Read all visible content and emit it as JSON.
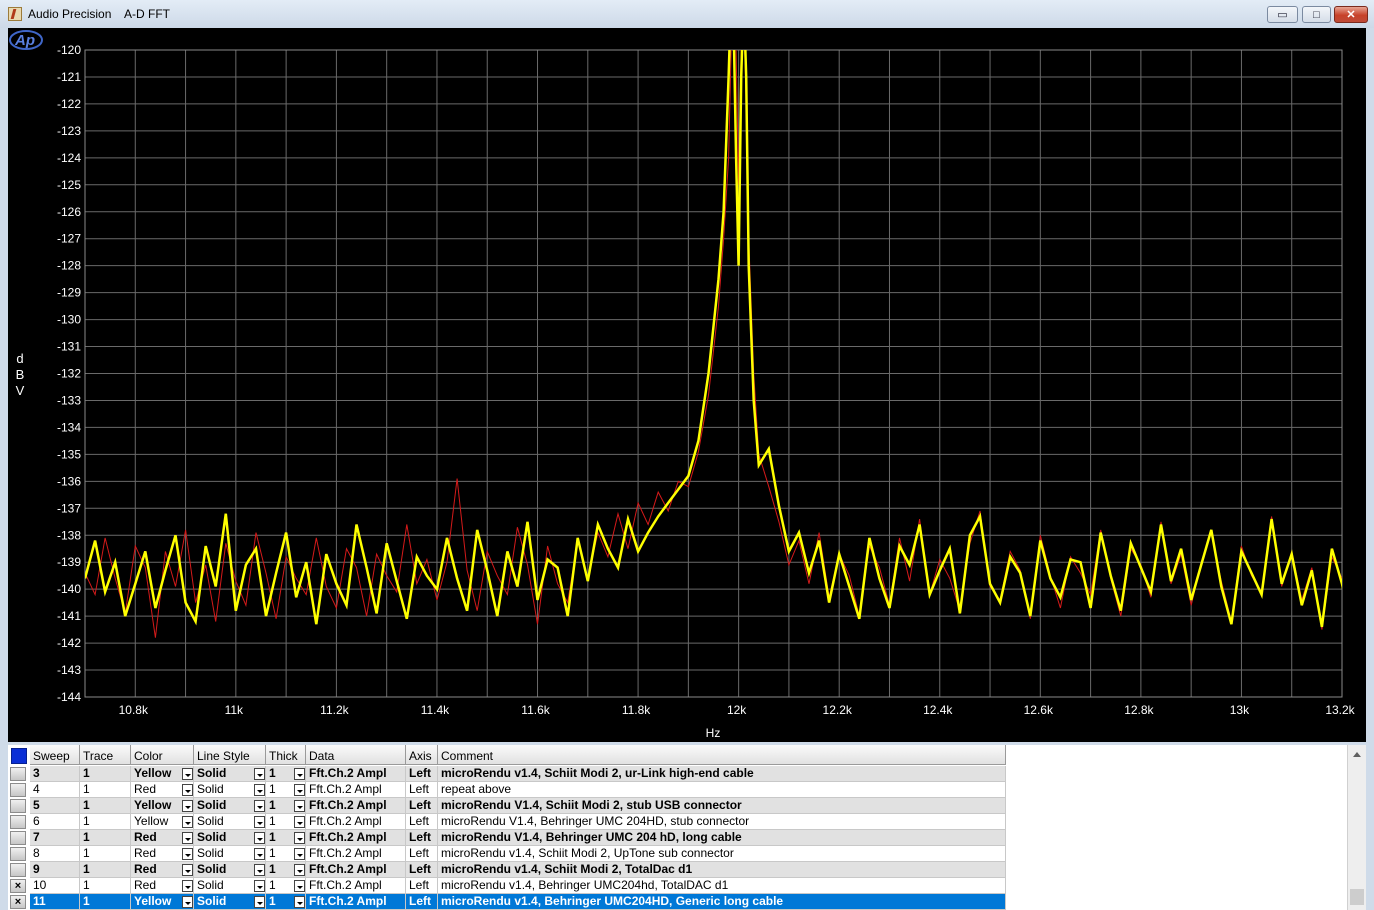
{
  "window": {
    "app_name": "Audio Precision",
    "document_title": "A-D FFT",
    "minimize": "▭",
    "maximize": "□",
    "close": "✕"
  },
  "chart_data": {
    "type": "line",
    "x": [
      10700,
      10720,
      10740,
      10760,
      10780,
      10800,
      10820,
      10840,
      10860,
      10880,
      10900,
      10920,
      10940,
      10960,
      10980,
      11000,
      11020,
      11040,
      11060,
      11080,
      11100,
      11120,
      11140,
      11160,
      11180,
      11200,
      11220,
      11240,
      11260,
      11280,
      11300,
      11320,
      11340,
      11360,
      11380,
      11400,
      11420,
      11440,
      11460,
      11480,
      11500,
      11520,
      11540,
      11560,
      11580,
      11600,
      11620,
      11640,
      11660,
      11680,
      11700,
      11720,
      11740,
      11760,
      11780,
      11800,
      11820,
      11840,
      11860,
      11880,
      11900,
      11920,
      11940,
      11960,
      11970,
      11980,
      11985,
      11990,
      11995,
      12000,
      12005,
      12010,
      12015,
      12020,
      12030,
      12040,
      12060,
      12080,
      12100,
      12120,
      12140,
      12160,
      12180,
      12200,
      12220,
      12240,
      12260,
      12280,
      12300,
      12320,
      12340,
      12360,
      12380,
      12400,
      12420,
      12440,
      12460,
      12480,
      12500,
      12520,
      12540,
      12560,
      12580,
      12600,
      12620,
      12640,
      12660,
      12680,
      12700,
      12720,
      12740,
      12760,
      12780,
      12800,
      12820,
      12840,
      12860,
      12880,
      12900,
      12920,
      12940,
      12960,
      12980,
      13000,
      13020,
      13040,
      13060,
      13080,
      13100,
      13120,
      13140,
      13160,
      13180,
      13200,
      13220
    ],
    "series": [
      {
        "color": "#d41a1a",
        "values": [
          -139.4,
          -140.2,
          -138.1,
          -139.6,
          -140.9,
          -138.4,
          -139.2,
          -141.8,
          -138.6,
          -139.9,
          -137.8,
          -140.5,
          -139.1,
          -141.2,
          -138.3,
          -139.7,
          -140.6,
          -137.9,
          -139.4,
          -141.1,
          -138.8,
          -139.6,
          -140.2,
          -138.1,
          -139.9,
          -140.7,
          -138.5,
          -139.2,
          -141.0,
          -138.7,
          -139.5,
          -140.1,
          -137.6,
          -139.8,
          -138.9,
          -140.4,
          -139.0,
          -135.9,
          -139.3,
          -140.8,
          -138.6,
          -139.5,
          -140.2,
          -137.7,
          -139.1,
          -141.3,
          -138.4,
          -139.8,
          -140.5,
          -138.2,
          -139.6,
          -137.9,
          -138.8,
          -137.2,
          -138.5,
          -136.8,
          -137.6,
          -136.4,
          -137.1,
          -136.0,
          -136.2,
          -134.9,
          -132.8,
          -129.5,
          -127.0,
          -124.0,
          -120.0,
          -118.5,
          -120.0,
          -125.0,
          -120.0,
          -118.5,
          -122.0,
          -127.0,
          -132.0,
          -135.0,
          -136.2,
          -137.5,
          -139.1,
          -138.2,
          -139.8,
          -137.9,
          -140.3,
          -138.7,
          -139.5,
          -141.0,
          -138.4,
          -139.2,
          -140.6,
          -138.1,
          -139.7,
          -137.4,
          -140.2,
          -138.9,
          -139.6,
          -140.8,
          -138.3,
          -137.1,
          -139.9,
          -140.4,
          -138.6,
          -139.3,
          -141.1,
          -138.0,
          -139.5,
          -140.7,
          -138.8,
          -139.4,
          -140.2,
          -137.8,
          -139.6,
          -141.0,
          -138.5,
          -139.1,
          -140.3,
          -137.5,
          -139.8,
          -138.7,
          -140.6,
          -139.0,
          -137.9,
          -139.7,
          -141.2,
          -138.4,
          -139.5,
          -140.1,
          -137.3,
          -139.9,
          -138.6,
          -140.4,
          -139.2,
          -141.5,
          -138.8,
          -139.6,
          -142.0
        ]
      },
      {
        "color": "#ffff00",
        "values": [
          -139.6,
          -138.2,
          -140.1,
          -139.0,
          -141.0,
          -139.8,
          -138.6,
          -140.7,
          -139.3,
          -138.0,
          -140.5,
          -141.2,
          -138.4,
          -139.9,
          -137.2,
          -140.8,
          -139.1,
          -138.5,
          -141.0,
          -139.4,
          -137.9,
          -140.3,
          -139.0,
          -141.3,
          -138.7,
          -139.8,
          -140.6,
          -137.6,
          -139.2,
          -140.9,
          -138.3,
          -139.7,
          -141.1,
          -138.8,
          -139.5,
          -140.0,
          -138.1,
          -139.6,
          -140.8,
          -137.8,
          -139.3,
          -141.0,
          -138.6,
          -139.9,
          -137.5,
          -140.4,
          -138.9,
          -139.2,
          -141.0,
          -138.1,
          -139.7,
          -137.6,
          -138.5,
          -139.2,
          -137.4,
          -138.6,
          -137.9,
          -137.3,
          -136.8,
          -136.3,
          -135.8,
          -134.5,
          -132.0,
          -128.5,
          -126.0,
          -121.0,
          -118.0,
          -119.0,
          -124.0,
          -128.0,
          -121.0,
          -118.0,
          -121.0,
          -128.0,
          -133.0,
          -135.4,
          -134.8,
          -136.9,
          -138.6,
          -137.9,
          -139.4,
          -138.2,
          -140.5,
          -138.7,
          -139.9,
          -141.1,
          -138.1,
          -139.6,
          -140.7,
          -138.4,
          -139.1,
          -137.6,
          -140.2,
          -139.3,
          -138.5,
          -140.9,
          -138.0,
          -137.3,
          -139.8,
          -140.5,
          -138.8,
          -139.4,
          -141.0,
          -138.2,
          -139.6,
          -140.3,
          -138.9,
          -139.0,
          -140.7,
          -137.9,
          -139.5,
          -140.8,
          -138.3,
          -139.2,
          -140.1,
          -137.6,
          -139.7,
          -138.5,
          -140.4,
          -139.1,
          -137.8,
          -139.9,
          -141.3,
          -138.6,
          -139.4,
          -140.2,
          -137.4,
          -139.8,
          -138.7,
          -140.6,
          -139.3,
          -141.4,
          -138.5,
          -139.8,
          -141.6
        ]
      }
    ],
    "xlim": [
      10700,
      13200
    ],
    "ylim": [
      -144,
      -120
    ],
    "xlabel": "Hz",
    "ylabel": "dBV",
    "ylabel_letters": [
      "d",
      "B",
      "V"
    ],
    "yticks": [
      -120,
      -121,
      -122,
      -123,
      -124,
      -125,
      -126,
      -127,
      -128,
      -129,
      -130,
      -131,
      -132,
      -133,
      -134,
      -135,
      -136,
      -137,
      -138,
      -139,
      -140,
      -141,
      -142,
      -143,
      -144
    ],
    "xticks": [
      10800,
      11000,
      11200,
      11400,
      11600,
      11800,
      12000,
      12200,
      12400,
      12600,
      12800,
      13000,
      13200
    ],
    "ytick_labels": [
      "-120",
      "-121",
      "-122",
      "-123",
      "-124",
      "-125",
      "-126",
      "-127",
      "-128",
      "-129",
      "-130",
      "-131",
      "-132",
      "-133",
      "-134",
      "-135",
      "-136",
      "-137",
      "-138",
      "-139",
      "-140",
      "-141",
      "-142",
      "-143",
      "-144"
    ],
    "xtick_labels": [
      "10.8k",
      "11k",
      "11.2k",
      "11.4k",
      "11.6k",
      "11.8k",
      "12k",
      "12.2k",
      "12.4k",
      "12.6k",
      "12.8k",
      "13k",
      "13.2k"
    ],
    "grid": true,
    "background": "#000000",
    "logo": "Ap"
  },
  "table": {
    "columns": [
      "Sweep",
      "Trace",
      "Color",
      "Line Style",
      "Thick",
      "Data",
      "Axis",
      "Comment"
    ],
    "rows": [
      {
        "checked": false,
        "bold": true,
        "sweep": "3",
        "trace": "1",
        "color": "Yellow",
        "style": "Solid",
        "thick": "1",
        "data": "Fft.Ch.2 Ampl",
        "axis": "Left",
        "comment": "microRendu v1.4, Schiit Modi 2, ur-Link high-end cable"
      },
      {
        "checked": false,
        "bold": false,
        "sweep": "4",
        "trace": "1",
        "color": "Red",
        "style": "Solid",
        "thick": "1",
        "data": "Fft.Ch.2 Ampl",
        "axis": "Left",
        "comment": "repeat above"
      },
      {
        "checked": false,
        "bold": true,
        "sweep": "5",
        "trace": "1",
        "color": "Yellow",
        "style": "Solid",
        "thick": "1",
        "data": "Fft.Ch.2 Ampl",
        "axis": "Left",
        "comment": "microRendu V1.4, Schiit Modi 2, stub USB connector"
      },
      {
        "checked": false,
        "bold": false,
        "sweep": "6",
        "trace": "1",
        "color": "Yellow",
        "style": "Solid",
        "thick": "1",
        "data": "Fft.Ch.2 Ampl",
        "axis": "Left",
        "comment": "microRendu V1.4, Behringer UMC 204HD, stub connector"
      },
      {
        "checked": false,
        "bold": true,
        "sweep": "7",
        "trace": "1",
        "color": "Red",
        "style": "Solid",
        "thick": "1",
        "data": "Fft.Ch.2 Ampl",
        "axis": "Left",
        "comment": "microRendu V1.4, Behringer UMC 204 hD, long cable"
      },
      {
        "checked": false,
        "bold": false,
        "sweep": "8",
        "trace": "1",
        "color": "Red",
        "style": "Solid",
        "thick": "1",
        "data": "Fft.Ch.2 Ampl",
        "axis": "Left",
        "comment": "microRendu v1.4, Schiit Modi 2, UpTone sub connector"
      },
      {
        "checked": false,
        "bold": true,
        "sweep": "9",
        "trace": "1",
        "color": "Red",
        "style": "Solid",
        "thick": "1",
        "data": "Fft.Ch.2 Ampl",
        "axis": "Left",
        "comment": "microRendu v1.4, Schiit Modi 2, TotalDac d1"
      },
      {
        "checked": true,
        "bold": false,
        "sweep": "10",
        "trace": "1",
        "color": "Red",
        "style": "Solid",
        "thick": "1",
        "data": "Fft.Ch.2 Ampl",
        "axis": "Left",
        "comment": "microRendu v1.4, Behringer UMC204hd, TotalDAC d1"
      },
      {
        "checked": true,
        "bold": true,
        "selected": true,
        "sweep": "11",
        "trace": "1",
        "color": "Yellow",
        "style": "Solid",
        "thick": "1",
        "data": "Fft.Ch.2 Ampl",
        "axis": "Left",
        "comment": "microRendu v1.4, Behringer UMC204HD, Generic long cable"
      }
    ]
  }
}
